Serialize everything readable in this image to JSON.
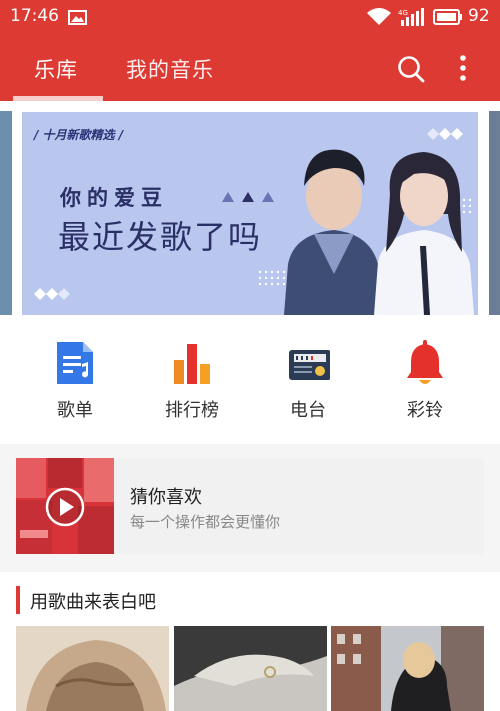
{
  "status_bar": {
    "time": "17:46",
    "battery": "92"
  },
  "tabs": [
    {
      "label": "乐库"
    },
    {
      "label": "我的音乐"
    }
  ],
  "banner": {
    "tagline": "/ 十月新歌精选 /",
    "title1": "你的爱豆",
    "title2": "最近发歌了吗"
  },
  "quick_entries": [
    {
      "label": "歌单",
      "icon": "playlist-icon",
      "color": "#3478e8"
    },
    {
      "label": "排行榜",
      "icon": "chart-bars-icon",
      "color": "#f5a024"
    },
    {
      "label": "电台",
      "icon": "radio-icon",
      "color": "#2b3a55"
    },
    {
      "label": "彩铃",
      "icon": "bell-icon",
      "color": "#e5312b"
    }
  ],
  "guess": {
    "title": "猜你喜欢",
    "subtitle": "每一个操作都会更懂你"
  },
  "section": {
    "title": "用歌曲来表白吧"
  },
  "colors": {
    "accent": "#dc3a33",
    "banner_bg": "#b9c6ee"
  }
}
